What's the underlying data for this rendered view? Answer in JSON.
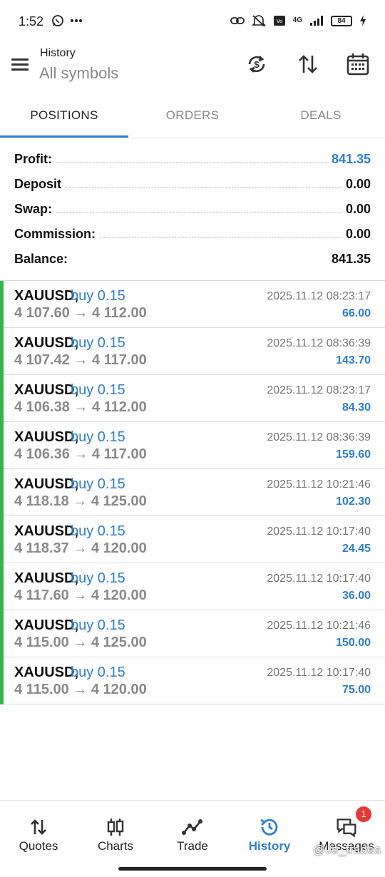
{
  "status_bar": {
    "time": "1:52",
    "network": "4G",
    "battery": "84"
  },
  "header": {
    "title": "History",
    "subtitle": "All symbols",
    "icons": [
      "menu-icon",
      "currency-refresh-icon",
      "sort-icon",
      "calendar-icon"
    ]
  },
  "tabs": [
    {
      "label": "POSITIONS",
      "active": true
    },
    {
      "label": "ORDERS",
      "active": false
    },
    {
      "label": "DEALS",
      "active": false
    }
  ],
  "summary": {
    "profit_label": "Profit:",
    "profit_value": "841.35",
    "deposit_label": "Deposit",
    "deposit_value": "0.00",
    "swap_label": "Swap:",
    "swap_value": "0.00",
    "commission_label": "Commission:",
    "commission_value": "0.00",
    "balance_label": "Balance:",
    "balance_value": "841.35"
  },
  "positions": [
    {
      "symbol": "XAUUSD,",
      "side": "buy 0.15",
      "prices": "4 107.60 → 4 112.00",
      "time": "2025.11.12 08:23:17",
      "profit": "66.00"
    },
    {
      "symbol": "XAUUSD,",
      "side": "buy 0.15",
      "prices": "4 107.42 → 4 117.00",
      "time": "2025.11.12 08:36:39",
      "profit": "143.70"
    },
    {
      "symbol": "XAUUSD,",
      "side": "buy 0.15",
      "prices": "4 106.38 → 4 112.00",
      "time": "2025.11.12 08:23:17",
      "profit": "84.30"
    },
    {
      "symbol": "XAUUSD,",
      "side": "buy 0.15",
      "prices": "4 106.36 → 4 117.00",
      "time": "2025.11.12 08:36:39",
      "profit": "159.60"
    },
    {
      "symbol": "XAUUSD,",
      "side": "buy 0.15",
      "prices": "4 118.18 → 4 125.00",
      "time": "2025.11.12 10:21:46",
      "profit": "102.30"
    },
    {
      "symbol": "XAUUSD,",
      "side": "buy 0.15",
      "prices": "4 118.37 → 4 120.00",
      "time": "2025.11.12 10:17:40",
      "profit": "24.45"
    },
    {
      "symbol": "XAUUSD,",
      "side": "buy 0.15",
      "prices": "4 117.60 → 4 120.00",
      "time": "2025.11.12 10:17:40",
      "profit": "36.00"
    },
    {
      "symbol": "XAUUSD,",
      "side": "buy 0.15",
      "prices": "4 115.00 → 4 125.00",
      "time": "2025.11.12 10:21:46",
      "profit": "150.00"
    },
    {
      "symbol": "XAUUSD,",
      "side": "buy 0.15",
      "prices": "4 115.00 → 4 120.00",
      "time": "2025.11.12 10:17:40",
      "profit": "75.00"
    }
  ],
  "bottom_nav": [
    {
      "label": "Quotes",
      "icon": "quotes-icon",
      "active": false
    },
    {
      "label": "Charts",
      "icon": "charts-icon",
      "active": false
    },
    {
      "label": "Trade",
      "icon": "trade-icon",
      "active": false
    },
    {
      "label": "History",
      "icon": "history-icon",
      "active": true
    },
    {
      "label": "Messages",
      "icon": "messages-icon",
      "active": false,
      "badge": "1"
    }
  ],
  "watermark": "@Je_trades",
  "colors": {
    "accent_blue": "#2d7fd3",
    "profit_green_bar": "#36b34a",
    "badge_red": "#e53935"
  }
}
